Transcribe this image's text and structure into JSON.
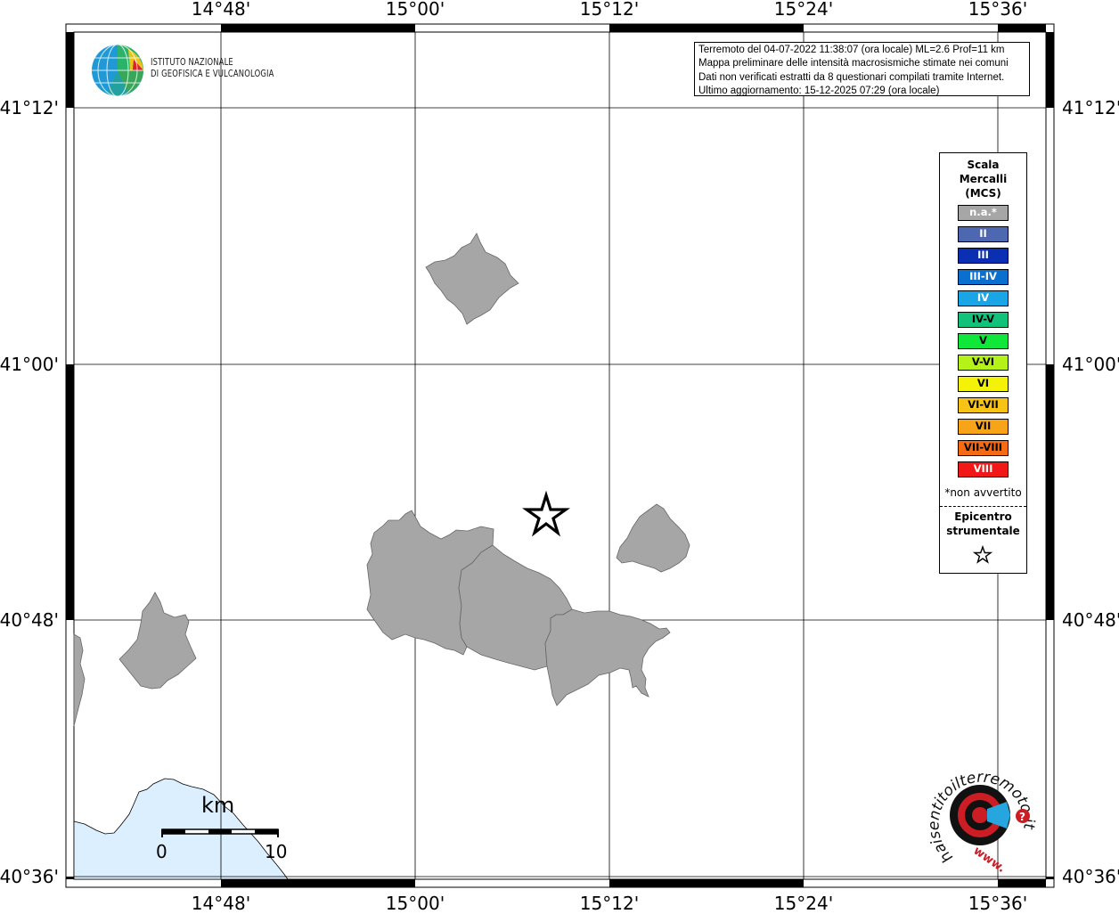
{
  "map": {
    "lon_labels": [
      "14°48'",
      "15°00'",
      "15°12'",
      "15°24'",
      "15°36'"
    ],
    "lat_labels": [
      "41°12'",
      "41°00'",
      "40°48'",
      "40°36'"
    ]
  },
  "info_box": {
    "line1": "Terremoto del 04-07-2022 11:38:07 (ora locale) ML=2.6 Prof=11 km",
    "line2": "Mappa preliminare delle intensità macrosismiche stimate nei comuni",
    "line3": "Dati non verificati estratti da 8 questionari compilati tramite Internet.",
    "line4": "Ultimo aggiornamento: 15-12-2025 07:29 (ora locale)"
  },
  "ingv": {
    "line1": "ISTITUTO NAZIONALE",
    "line2": "DI GEOFISICA E VULCANOLOGIA"
  },
  "legend": {
    "title_line1": "Scala",
    "title_line2": "Mercalli",
    "title_line3": "(MCS)",
    "classes": [
      {
        "label": "n.a.*",
        "color": "#a6a6a6",
        "text_color": "#ffffff"
      },
      {
        "label": "II",
        "color": "#4d68b0",
        "text_color": "#ffffff"
      },
      {
        "label": "III",
        "color": "#0b2fb3",
        "text_color": "#ffffff"
      },
      {
        "label": "III-IV",
        "color": "#0b6fd0",
        "text_color": "#ffffff"
      },
      {
        "label": "IV",
        "color": "#1aa6e6",
        "text_color": "#ffffff"
      },
      {
        "label": "IV-V",
        "color": "#13c27a",
        "text_color": "#000000"
      },
      {
        "label": "V",
        "color": "#11e63a",
        "text_color": "#000000"
      },
      {
        "label": "V-VI",
        "color": "#b4f21a",
        "text_color": "#000000"
      },
      {
        "label": "VI",
        "color": "#f5f20a",
        "text_color": "#000000"
      },
      {
        "label": "VI-VII",
        "color": "#f7c416",
        "text_color": "#000000"
      },
      {
        "label": "VII",
        "color": "#f7a418",
        "text_color": "#000000"
      },
      {
        "label": "VII-VIII",
        "color": "#f56a12",
        "text_color": "#000000"
      },
      {
        "label": "VIII",
        "color": "#f21818",
        "text_color": "#ffffff"
      }
    ],
    "note": "*non avvertito",
    "epicenter_line1": "Epicentro",
    "epicenter_line2": "strumentale"
  },
  "scale_bar": {
    "unit": "km",
    "min": "0",
    "max": "10"
  },
  "hst_logo": {
    "ring_text": "haisentitoilterremoto.it",
    "www": "www."
  },
  "colors": {
    "land": "#a6a6a6",
    "sea_coast": "#dcefff",
    "epicenter": "#000000"
  }
}
